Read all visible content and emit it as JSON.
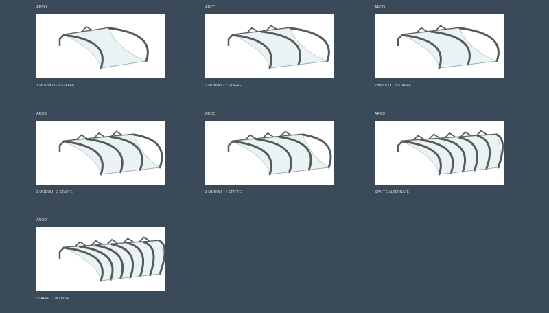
{
  "gallery": {
    "items": [
      {
        "title": "ARCO",
        "caption": "1 MODULO - 2 STAFFE",
        "image": "canopy-1-module-2-brackets",
        "modules": 1
      },
      {
        "title": "ARCO",
        "caption": "2 MODULI - 2 STAFFE",
        "image": "canopy-2-modules-2-brackets",
        "modules": 2
      },
      {
        "title": "ARCO",
        "caption": "2 MODULI - 3 STAFFE",
        "image": "canopy-2-modules-3-brackets",
        "modules": 2
      },
      {
        "title": "ARCO",
        "caption": "3 MODULI - 2 STAFFE",
        "image": "canopy-3-modules-2-brackets",
        "modules": 3
      },
      {
        "title": "ARCO",
        "caption": "3 MODULI - 4 STAFFE",
        "image": "canopy-3-modules-4-brackets",
        "modules": 3
      },
      {
        "title": "ARCO",
        "caption": "STAFFE ALTERNATE",
        "image": "canopy-alternate-brackets",
        "modules": 5
      },
      {
        "title": "ARCO",
        "caption": "STAFFE CONTINUE",
        "image": "canopy-continuous-brackets",
        "modules": 6
      }
    ]
  },
  "colors": {
    "background": "#3b4a58",
    "frame": "#58595b",
    "panel": "#e9f3f3"
  }
}
